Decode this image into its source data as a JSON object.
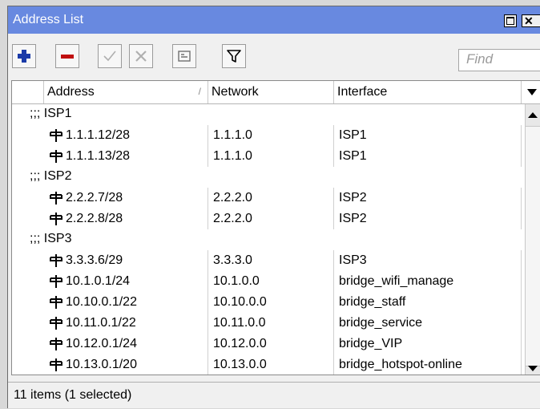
{
  "window": {
    "title": "Address List"
  },
  "toolbar": {
    "find_placeholder": "Find"
  },
  "table": {
    "columns": {
      "address": "Address",
      "network": "Network",
      "interface": "Interface"
    },
    "sort_indicator": "/",
    "rows": [
      {
        "type": "comment",
        "text": ";;; ISP1"
      },
      {
        "type": "data",
        "address": "1.1.1.12/28",
        "network": "1.1.1.0",
        "interface": "ISP1"
      },
      {
        "type": "data",
        "address": "1.1.1.13/28",
        "network": "1.1.1.0",
        "interface": "ISP1"
      },
      {
        "type": "comment",
        "text": ";;; ISP2"
      },
      {
        "type": "data",
        "address": "2.2.2.7/28",
        "network": "2.2.2.0",
        "interface": "ISP2"
      },
      {
        "type": "data",
        "address": "2.2.2.8/28",
        "network": "2.2.2.0",
        "interface": "ISP2"
      },
      {
        "type": "comment",
        "text": ";;; ISP3"
      },
      {
        "type": "data",
        "address": "3.3.3.6/29",
        "network": "3.3.3.0",
        "interface": "ISP3"
      },
      {
        "type": "data",
        "address": "10.1.0.1/24",
        "network": "10.1.0.0",
        "interface": "bridge_wifi_manage"
      },
      {
        "type": "data",
        "address": "10.10.0.1/22",
        "network": "10.10.0.0",
        "interface": "bridge_staff"
      },
      {
        "type": "data",
        "address": "10.11.0.1/22",
        "network": "10.11.0.0",
        "interface": "bridge_service"
      },
      {
        "type": "data",
        "address": "10.12.0.1/24",
        "network": "10.12.0.0",
        "interface": "bridge_VIP"
      },
      {
        "type": "data",
        "address": "10.13.0.1/20",
        "network": "10.13.0.0",
        "interface": "bridge_hotspot-online"
      }
    ]
  },
  "status": {
    "text": "11 items (1 selected)"
  },
  "icons": {
    "add": "plus-icon",
    "remove": "minus-icon",
    "enable": "check-icon",
    "disable": "cross-icon",
    "comment": "note-icon",
    "filter": "funnel-icon",
    "address_row": "address-plug-icon"
  },
  "colors": {
    "titlebar": "#6889e0",
    "add": "#1a3aa8",
    "remove": "#c01010",
    "address_icon": "#000000"
  }
}
